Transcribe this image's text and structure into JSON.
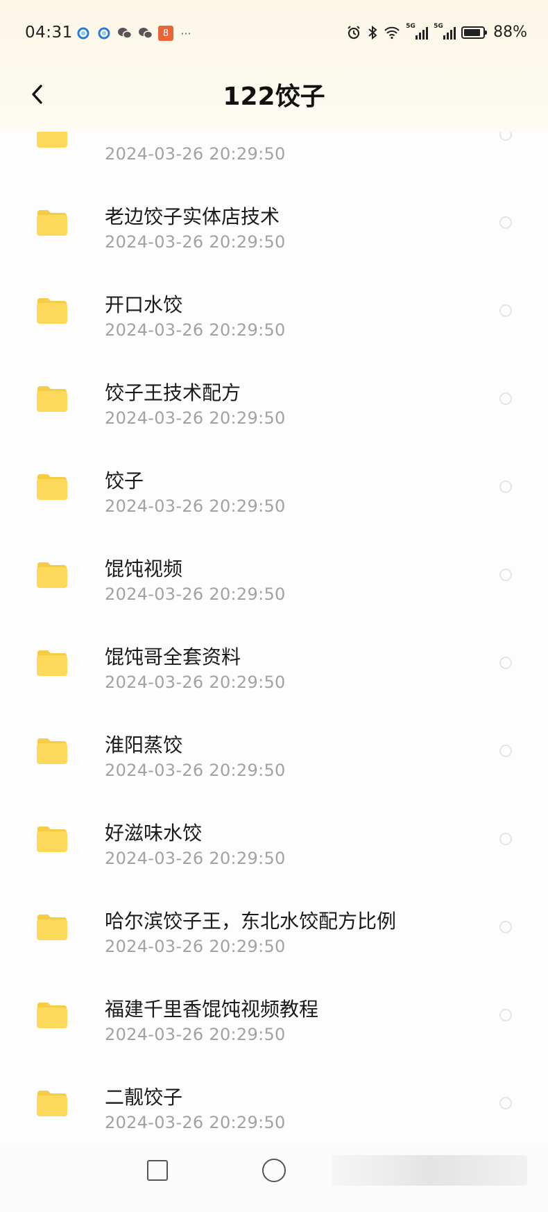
{
  "status_bar": {
    "time": "04:31",
    "battery_pct": "88%",
    "battery_level": 0.88,
    "network": "5G",
    "more": "···",
    "left_icons": [
      "circle-notification-icon",
      "circle-notification-icon",
      "wechat-icon",
      "wechat-icon",
      "app-notification-icon",
      "more-icon"
    ],
    "right_icons": [
      "alarm-icon",
      "bluetooth-icon",
      "wifi-icon",
      "signal-icon",
      "signal-icon",
      "battery-icon"
    ]
  },
  "header": {
    "title": "122饺子",
    "back_icon": "chevron-left-icon"
  },
  "folders": [
    {
      "name": "",
      "date": "2024-03-26  20:29:50"
    },
    {
      "name": "老边饺子实体店技术",
      "date": "2024-03-26  20:29:50"
    },
    {
      "name": "开口水饺",
      "date": "2024-03-26  20:29:50"
    },
    {
      "name": "饺子王技术配方",
      "date": "2024-03-26  20:29:50"
    },
    {
      "name": "饺子",
      "date": "2024-03-26  20:29:50"
    },
    {
      "name": "馄饨视频",
      "date": "2024-03-26  20:29:50"
    },
    {
      "name": "馄饨哥全套资料",
      "date": "2024-03-26  20:29:50"
    },
    {
      "name": "淮阳蒸饺",
      "date": "2024-03-26  20:29:50"
    },
    {
      "name": "好滋味水饺",
      "date": "2024-03-26  20:29:50"
    },
    {
      "name": "哈尔滨饺子王，东北水饺配方比例",
      "date": "2024-03-26  20:29:50"
    },
    {
      "name": "福建千里香馄饨视频教程",
      "date": "2024-03-26  20:29:50"
    },
    {
      "name": "二靓饺子",
      "date": "2024-03-26  20:29:50"
    }
  ],
  "colors": {
    "folder": "#fcd95a",
    "folder_tab": "#f6cc45",
    "date_text": "#a2a2a6",
    "header_bg": "#fbf6e6"
  },
  "nav_bar": {
    "icons": [
      "recent-apps-icon",
      "home-icon"
    ]
  }
}
